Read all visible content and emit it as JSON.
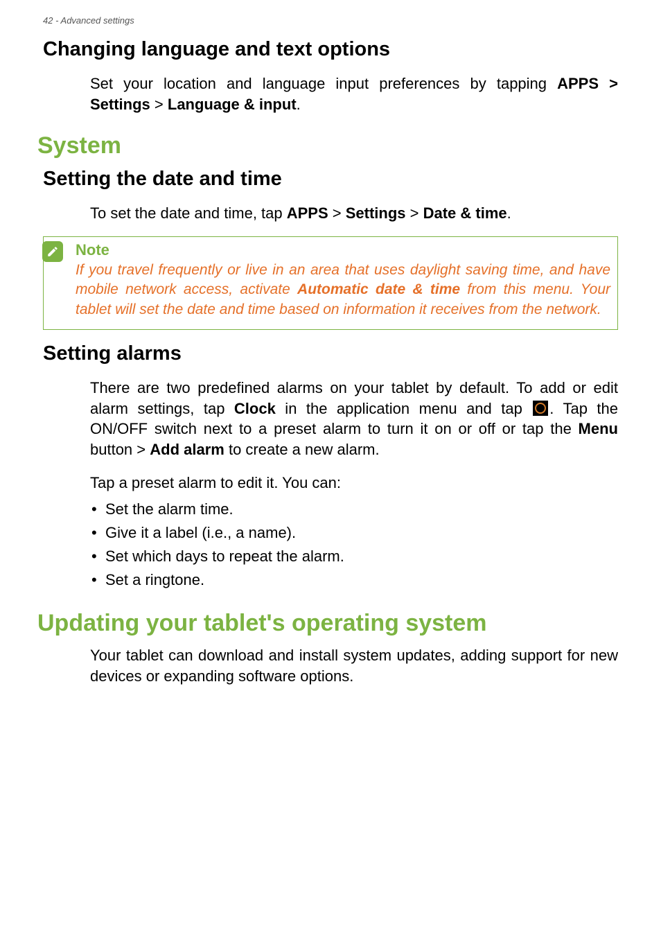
{
  "header": "42 - Advanced settings",
  "h2_lang": "Changing language and text options",
  "p_lang_1": "Set your location and language input preferences by tapping ",
  "p_lang_b1": "APPS > Settings",
  "p_lang_gt": " > ",
  "p_lang_b2": "Language & input",
  "period": ".",
  "h1_system": "System",
  "h2_date": "Setting the date and time",
  "p_date_1": "To set the date and time, tap ",
  "p_date_b1": "APPS",
  "p_date_b2": "Settings",
  "p_date_b3": "Date & time",
  "note_title": "Note",
  "note_body_1": "If you travel frequently or live in an area that uses daylight saving time, and have mobile network access, activate ",
  "note_body_b": "Automatic date & time",
  "note_body_2": " from this menu. Your tablet will set the date and time based on information it receives from the network.",
  "h2_alarms": "Setting alarms",
  "p_alarms_1a": "There are two predefined alarms on your tablet by default. To add or edit alarm settings, tap ",
  "p_alarms_clock": "Clock",
  "p_alarms_1b": " in the application menu and tap ",
  "p_alarms_1c": ". Tap the ON/OFF switch next to a preset alarm to turn it on or off or tap the ",
  "p_alarms_menu": "Menu",
  "p_alarms_1d": " button > ",
  "p_alarms_add": "Add alarm",
  "p_alarms_1e": " to create a new alarm.",
  "p_alarms_2": "Tap a preset alarm to edit it. You can:",
  "bullets": [
    "Set the alarm time.",
    "Give it a label (i.e., a name).",
    "Set which days to repeat the alarm.",
    "Set a ringtone."
  ],
  "h1_updating": "Updating your tablet's operating system",
  "p_updating": "Your tablet can download and install system updates, adding support for new devices or expanding software options."
}
